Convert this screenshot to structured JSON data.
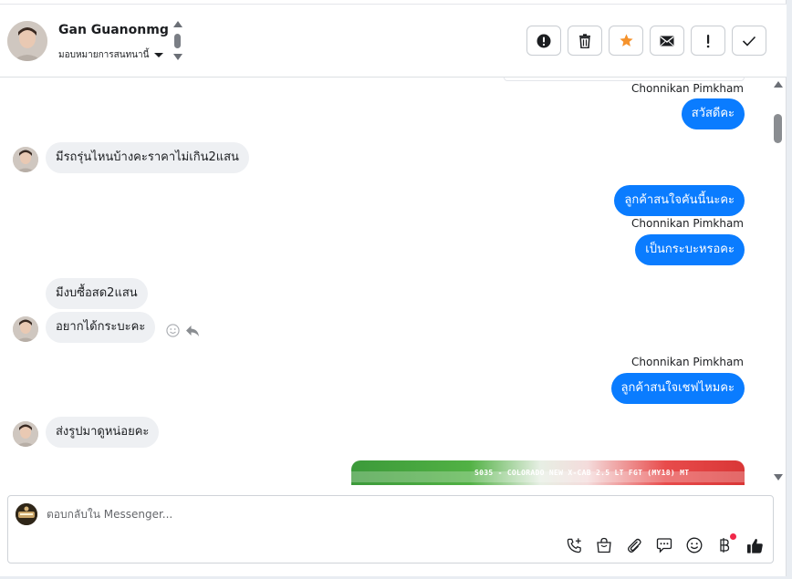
{
  "header": {
    "contact_name": "Gan Guanonmg",
    "assign_label": "มอบหมายการสนทนานี้"
  },
  "conversation": {
    "messages": [
      {
        "id": "m1",
        "direction": "out",
        "sender": "Chonnikan Pimkham",
        "text": "สวัสดีคะ"
      },
      {
        "id": "m2",
        "direction": "in",
        "text": "มีรถรุ่นไหนบ้างคะราคาไม่เกิน2แสน"
      },
      {
        "id": "m3",
        "direction": "out",
        "text": "ลูกค้าสนใจคันนี้นะคะ"
      },
      {
        "id": "m4",
        "direction": "out",
        "sender": "Chonnikan Pimkham",
        "text": "เป็นกระบะหรอคะ"
      },
      {
        "id": "m5",
        "direction": "in",
        "text": "มีงบซื้อสด2แสน"
      },
      {
        "id": "m6",
        "direction": "in",
        "text": "อยากได้กระบะคะ"
      },
      {
        "id": "m7",
        "direction": "out",
        "sender": "Chonnikan Pimkham",
        "text": "ลูกค้าสนใจเชฟไหมคะ"
      },
      {
        "id": "m8",
        "direction": "in",
        "text": "ส่งรูปมาดูหน่อยคะ"
      }
    ],
    "attachment": {
      "caption": "S035 - COLORADO NEW X-CAB 2.5 LT FGT (MY18) MT"
    }
  },
  "composer": {
    "placeholder": "ตอบกลับใน Messenger..."
  },
  "icons": {
    "toolbar": [
      "alert-circle-icon",
      "trash-icon",
      "star-icon",
      "envelope-icon",
      "exclamation-icon",
      "check-icon"
    ],
    "composer_tools": [
      "add-call-icon",
      "shopping-bag-icon",
      "paperclip-icon",
      "speech-bubble-icon",
      "smiley-icon",
      "baht-icon",
      "thumbs-up-icon"
    ]
  },
  "colors": {
    "outgoing_bubble": "#0a7cff",
    "incoming_bubble": "#eef0f3",
    "star_accent": "#f5922b",
    "notification_dot": "#f02849"
  }
}
